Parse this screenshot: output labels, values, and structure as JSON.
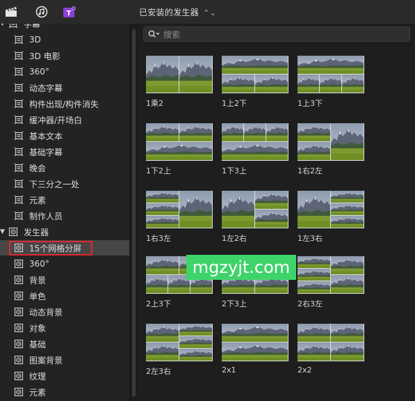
{
  "toolbar": {
    "title": "已安装的发生器",
    "icons": [
      "clapper-icon",
      "music-icon",
      "titles-icon"
    ]
  },
  "sidebar": {
    "rows": [
      {
        "kind": "cat",
        "label": "字幕",
        "icon": "titles-icon",
        "expanded": true
      },
      {
        "kind": "item",
        "label": "3D",
        "icon": "title-frame-icon"
      },
      {
        "kind": "item",
        "label": "3D 电影",
        "icon": "title-frame-icon"
      },
      {
        "kind": "item",
        "label": "360°",
        "icon": "title-frame-icon"
      },
      {
        "kind": "item",
        "label": "动态字幕",
        "icon": "title-frame-icon"
      },
      {
        "kind": "item",
        "label": "构件出现/构件消失",
        "icon": "title-frame-icon"
      },
      {
        "kind": "item",
        "label": "缓冲器/开场白",
        "icon": "title-frame-icon"
      },
      {
        "kind": "item",
        "label": "基本文本",
        "icon": "title-frame-icon"
      },
      {
        "kind": "item",
        "label": "基础字幕",
        "icon": "title-frame-icon"
      },
      {
        "kind": "item",
        "label": "晚会",
        "icon": "title-frame-icon"
      },
      {
        "kind": "item",
        "label": "下三分之一处",
        "icon": "title-frame-icon"
      },
      {
        "kind": "item",
        "label": "元素",
        "icon": "title-frame-icon"
      },
      {
        "kind": "item",
        "label": "制作人员",
        "icon": "title-frame-icon"
      },
      {
        "kind": "cat",
        "label": "发生器",
        "icon": "generator-icon",
        "expanded": true
      },
      {
        "kind": "item",
        "label": "15个网格分屏",
        "icon": "generator-icon",
        "selected": true
      },
      {
        "kind": "item",
        "label": "360°",
        "icon": "generator-icon"
      },
      {
        "kind": "item",
        "label": "背景",
        "icon": "generator-icon"
      },
      {
        "kind": "item",
        "label": "单色",
        "icon": "generator-icon"
      },
      {
        "kind": "item",
        "label": "动态背景",
        "icon": "generator-icon"
      },
      {
        "kind": "item",
        "label": "对象",
        "icon": "generator-icon"
      },
      {
        "kind": "item",
        "label": "基础",
        "icon": "generator-icon"
      },
      {
        "kind": "item",
        "label": "图案背景",
        "icon": "generator-icon"
      },
      {
        "kind": "item",
        "label": "纹理",
        "icon": "generator-icon"
      },
      {
        "kind": "item",
        "label": "元素",
        "icon": "generator-icon"
      }
    ]
  },
  "search": {
    "placeholder": "搜索"
  },
  "grid": {
    "tiles": [
      {
        "label": "1乘2",
        "layout": "1x2"
      },
      {
        "label": "1上2下",
        "layout": "1top2bottom"
      },
      {
        "label": "1上3下",
        "layout": "1top3bottom"
      },
      {
        "label": "1下2上",
        "layout": "2top1bottom"
      },
      {
        "label": "1下3上",
        "layout": "3top1bottom"
      },
      {
        "label": "1右2左",
        "layout": "2left1right"
      },
      {
        "label": "1右3左",
        "layout": "3left1right"
      },
      {
        "label": "1左2右",
        "layout": "1left2right"
      },
      {
        "label": "1左3右",
        "layout": "1left3right"
      },
      {
        "label": "2上3下",
        "layout": "2top3bottom"
      },
      {
        "label": "2下3上",
        "layout": "3top2bottom"
      },
      {
        "label": "2右3左",
        "layout": "3left2right"
      },
      {
        "label": "2左3右",
        "layout": "2left3right"
      },
      {
        "label": "2x1",
        "layout": "2x1"
      },
      {
        "label": "2x2",
        "layout": "2x2"
      }
    ]
  },
  "watermark": "mgzyjt.com",
  "colors": {
    "accent_purple": "#8b3fd9",
    "selection": "#464646",
    "highlight_box": "#e0282e",
    "watermark_bg": "#3fd36b"
  }
}
